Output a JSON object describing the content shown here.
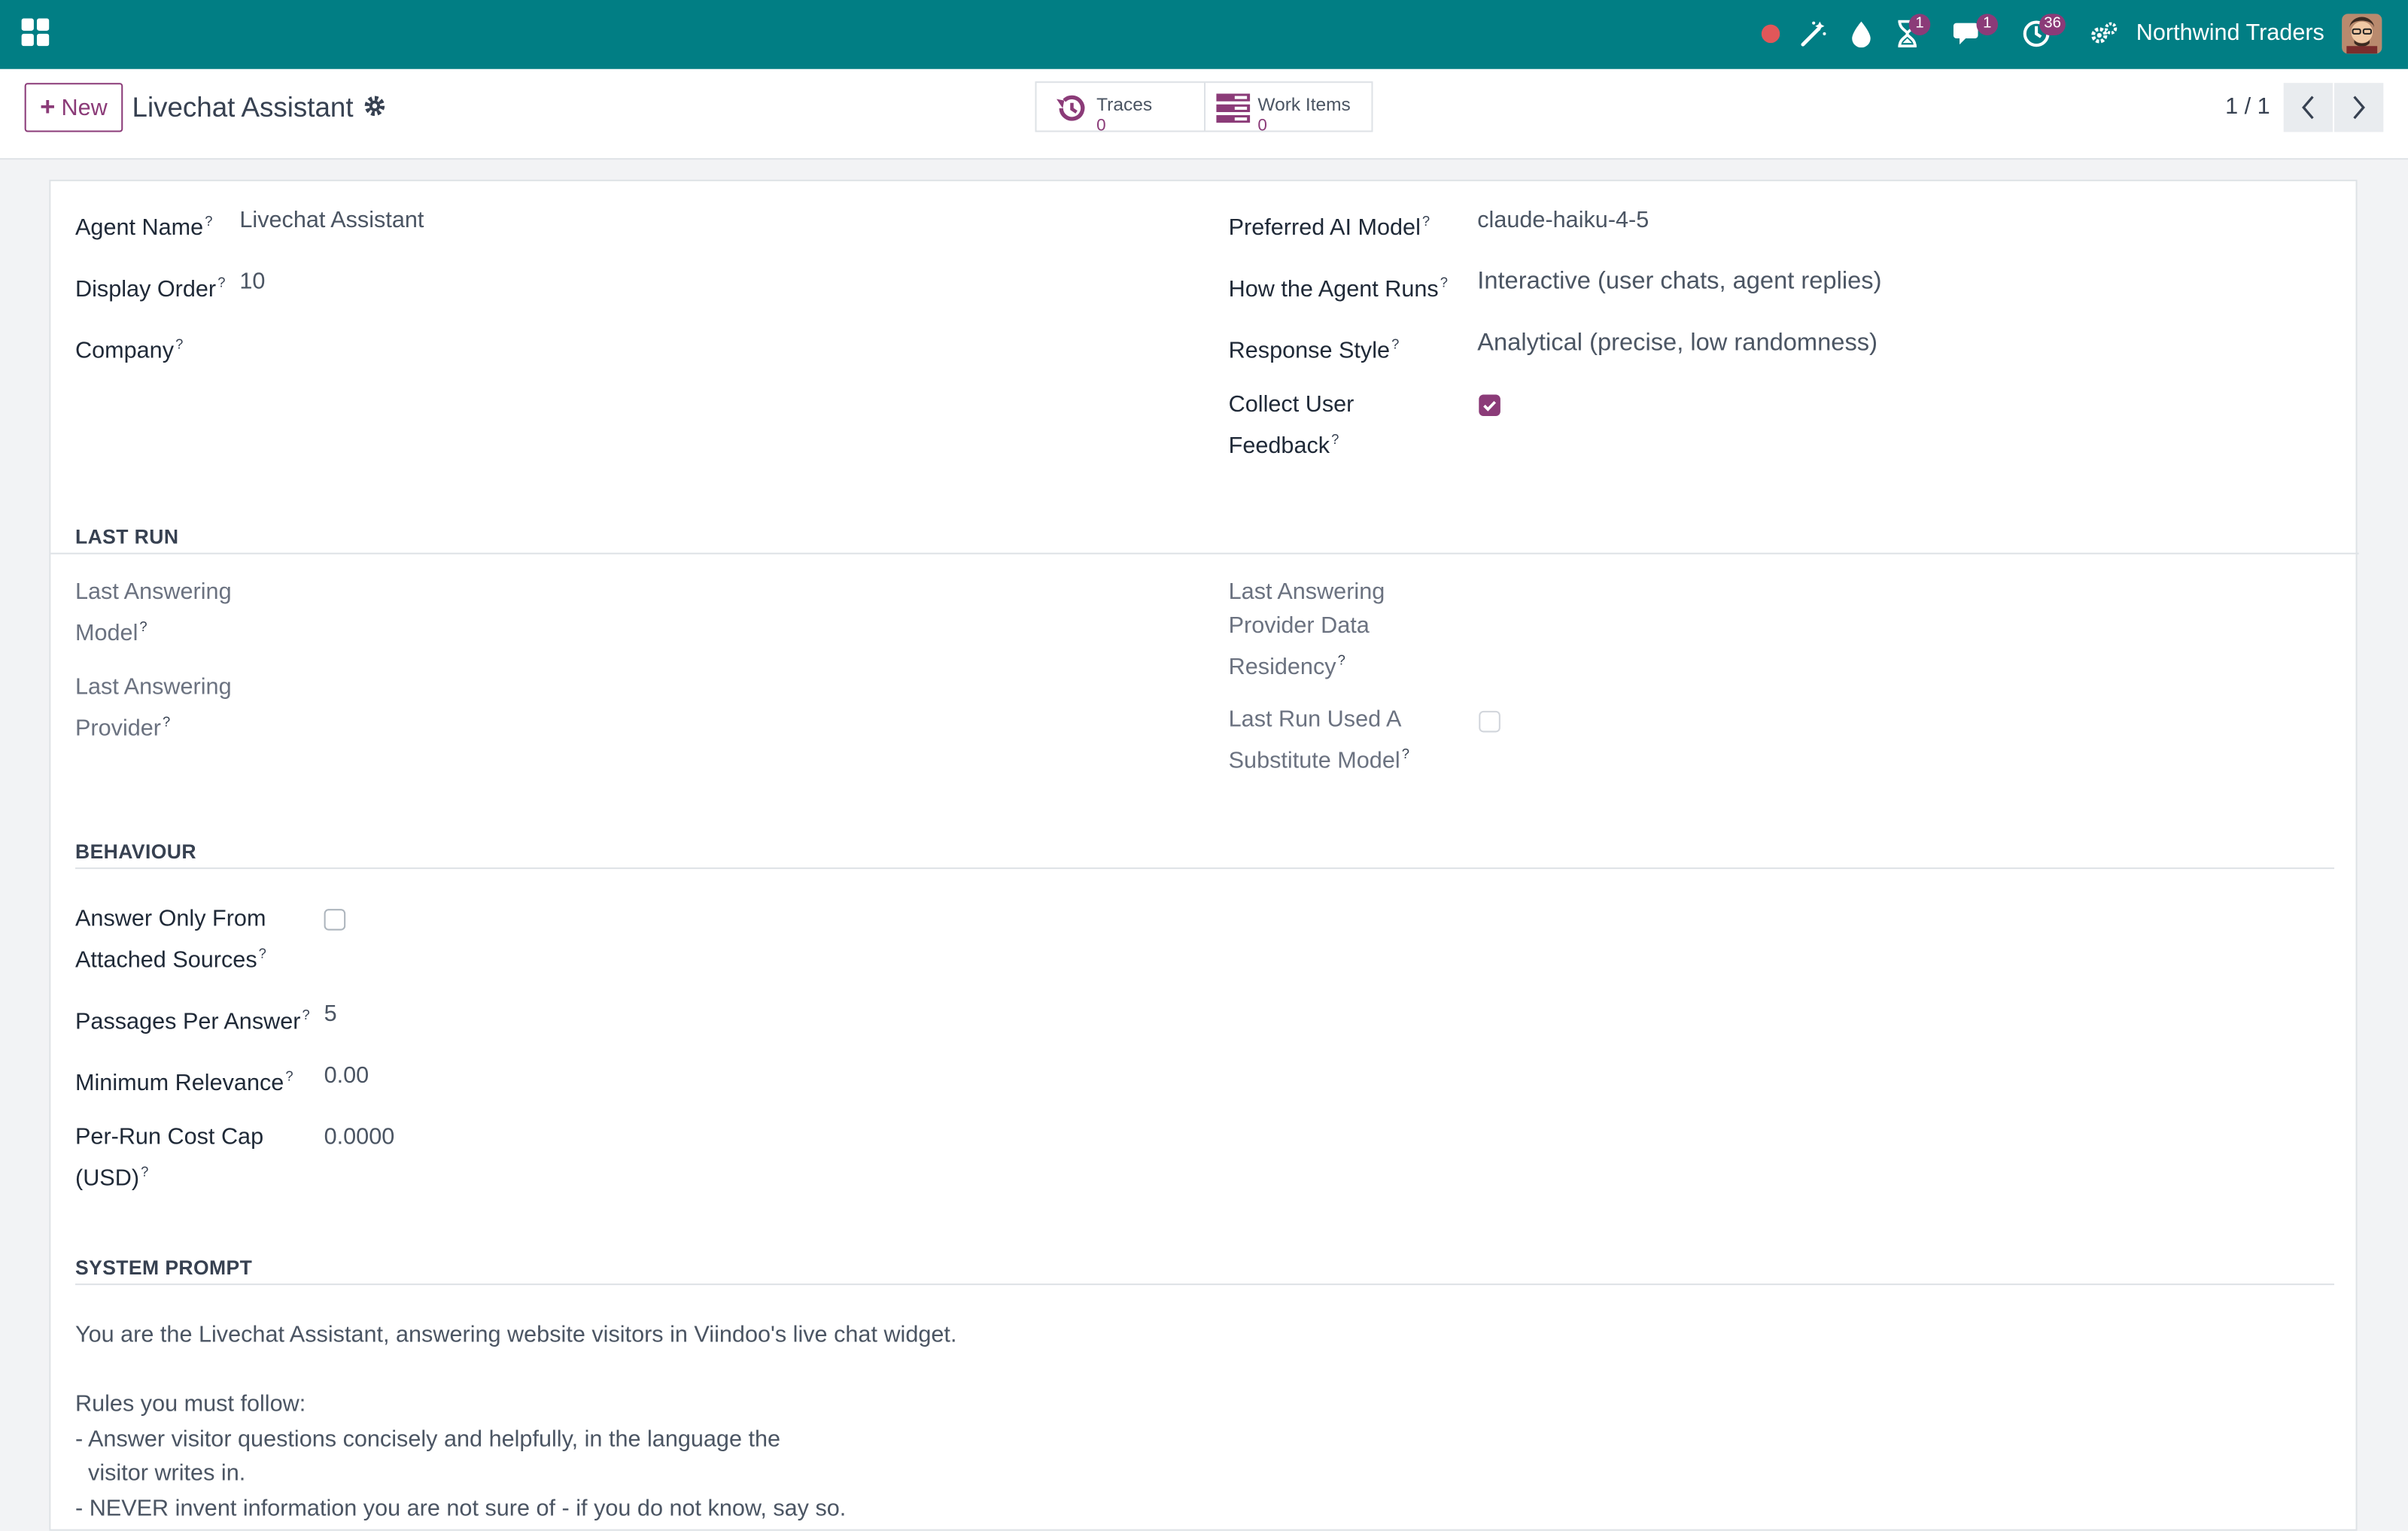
{
  "topbar": {
    "company": "Northwind Traders",
    "activity_badge": "1",
    "messages_badge": "1",
    "clock_badge": "36",
    "icons": [
      "apps-icon",
      "record-dot-icon",
      "magic-wand-icon",
      "drop-icon",
      "hourglass-icon",
      "chat-icon",
      "clock-icon",
      "settings-icon"
    ],
    "accent": "#017e84"
  },
  "control": {
    "new_label": "New",
    "title": "Livechat Assistant",
    "traces_label": "Traces",
    "traces_count": "0",
    "workitems_label": "Work Items",
    "workitems_count": "0",
    "pager": "1 / 1"
  },
  "fields": {
    "agent_name": {
      "label": "Agent Name",
      "value": "Livechat Assistant"
    },
    "display_order": {
      "label": "Display Order",
      "value": "10"
    },
    "company": {
      "label": "Company",
      "value": ""
    },
    "preferred_model": {
      "label": "Preferred AI Model",
      "value": "claude-haiku-4-5"
    },
    "how_runs": {
      "label": "How the Agent Runs",
      "value": "Interactive (user chats, agent replies)"
    },
    "response_style": {
      "label": "Response Style",
      "value": "Analytical (precise, low randomness)"
    },
    "collect_feedback": {
      "label_1": "Collect User",
      "label_2": "Feedback",
      "checked": true
    }
  },
  "last_run": {
    "title": "LAST RUN",
    "model_label_1": "Last Answering",
    "model_label_2": "Model",
    "provider_label_1": "Last Answering",
    "provider_label_2": "Provider",
    "residency_label_1": "Last Answering",
    "residency_label_2": "Provider Data",
    "residency_label_3": "Residency",
    "substitute_label_1": "Last Run Used A",
    "substitute_label_2": "Substitute Model",
    "substitute_checked": false
  },
  "behaviour": {
    "title": "BEHAVIOUR",
    "only_sources_label_1": "Answer Only From",
    "only_sources_label_2": "Attached Sources",
    "only_sources_checked": false,
    "passages_label": "Passages Per Answer",
    "passages_value": "5",
    "min_relevance_label": "Minimum Relevance",
    "min_relevance_value": "0.00",
    "cost_cap_label_1": "Per-Run Cost Cap",
    "cost_cap_label_2": "(USD)",
    "cost_cap_value": "0.0000"
  },
  "system_prompt": {
    "title": "SYSTEM PROMPT",
    "lines": [
      "You are the Livechat Assistant, answering website visitors in Viindoo's live chat widget.",
      "",
      "Rules you must follow:",
      "- Answer visitor questions concisely and helpfully, in the language the",
      "  visitor writes in.",
      "- NEVER invent information you are not sure of - if you do not know, say so."
    ]
  },
  "help_mark": "?"
}
